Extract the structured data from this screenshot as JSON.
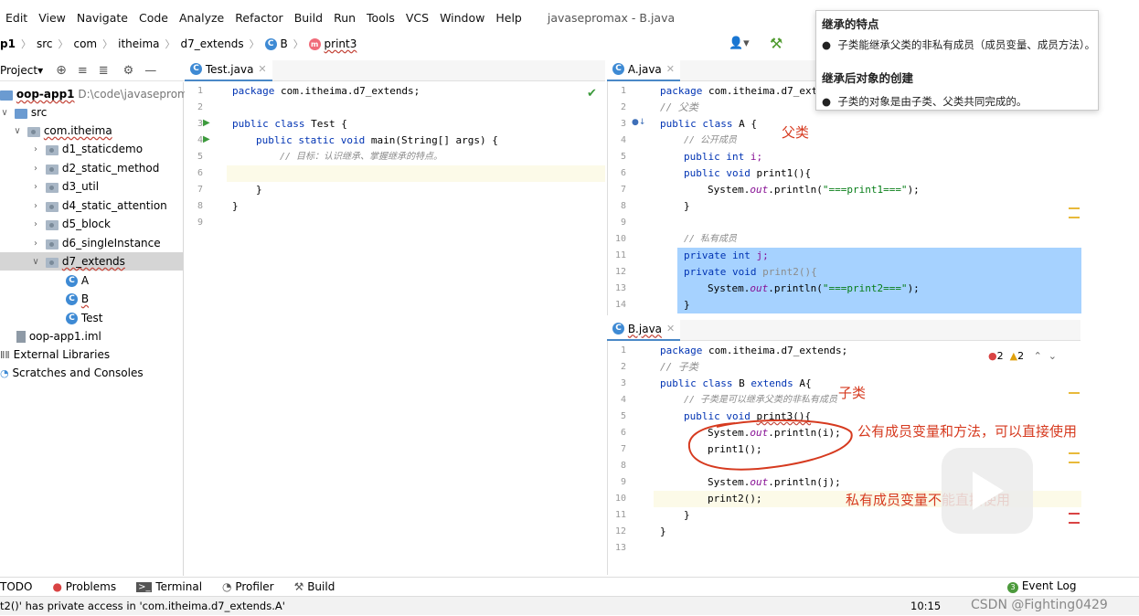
{
  "menu": [
    "Edit",
    "View",
    "Navigate",
    "Code",
    "Analyze",
    "Refactor",
    "Build",
    "Run",
    "Tools",
    "VCS",
    "Window",
    "Help"
  ],
  "window_title": "javasepromax - B.java",
  "breadcrumb": {
    "project": "p1",
    "items": [
      "src",
      "com",
      "itheima",
      "d7_extends"
    ],
    "class_name": "B",
    "method_name": "print3"
  },
  "project_panel": {
    "title": "Project",
    "root_name": "oop-app1",
    "root_path": "D:\\code\\javasepromax\\",
    "src": "src",
    "package": "com.itheima",
    "folders": [
      "d1_staticdemo",
      "d2_static_method",
      "d3_util",
      "d4_static_attention",
      "d5_block",
      "d6_singleInstance",
      "d7_extends"
    ],
    "classes": [
      "A",
      "B",
      "Test"
    ],
    "iml": "oop-app1.iml",
    "external": "External Libraries",
    "scratches": "Scratches and Consoles"
  },
  "test_editor": {
    "tab": "Test.java",
    "line_numbers": [
      "1",
      "2",
      "3",
      "4",
      "5",
      "6",
      "7",
      "8",
      "9"
    ],
    "lines": {
      "l1_kw": "package ",
      "l1_rest": "com.itheima.d7_extends;",
      "l3_kw": "public class ",
      "l3_rest": "Test {",
      "l4_kw": "public static void ",
      "l4_rest": "main(String[] args) {",
      "l5": "// 目标：认识继承、掌握继承的特点。",
      "l7": "}",
      "l8": "}"
    }
  },
  "a_editor": {
    "tab": "A.java",
    "line_numbers": [
      "1",
      "2",
      "3",
      "4",
      "5",
      "6",
      "7",
      "8",
      "9",
      "10",
      "11",
      "12",
      "13",
      "14"
    ],
    "lines": {
      "l1_kw": "package ",
      "l1_rest": "com.itheima.d7_ext",
      "l2": "// 父类",
      "l3_kw": "public class ",
      "l3_rest": "A {",
      "l4": "// 公开成员",
      "l5_kw": "public int ",
      "l5_rest": "i;",
      "l6_kw": "public void ",
      "l6_rest": "print1(){",
      "l7_a": "System.",
      "l7_b": "out",
      "l7_c": ".println(",
      "l7_d": "\"===print1===\"",
      "l7_e": ");",
      "l8": "}",
      "l10": "// 私有成员",
      "l11_kw": "private int ",
      "l11_rest": "j;",
      "l12_kw": "private void ",
      "l12_rest": "print2(){",
      "l13_a": "System.",
      "l13_b": "out",
      "l13_c": ".println(",
      "l13_d": "\"===print2===\"",
      "l13_e": ");",
      "l14": "}"
    }
  },
  "b_editor": {
    "tab": "B.java",
    "line_numbers": [
      "1",
      "2",
      "3",
      "4",
      "5",
      "6",
      "7",
      "8",
      "9",
      "10",
      "11",
      "12",
      "13"
    ],
    "errors": "2",
    "warnings": "2",
    "lines": {
      "l1_kw": "package ",
      "l1_rest": "com.itheima.d7_extends;",
      "l2": "// 子类",
      "l3_kw": "public class ",
      "l3_mid": "B ",
      "l3_kw2": "extends ",
      "l3_rest": "A{",
      "l4": "// 子类是可以继承父类的非私有成员",
      "l5_kw": "public void ",
      "l5_rest": "print3(){",
      "l6_a": "System.",
      "l6_b": "out",
      "l6_c": ".println(i);",
      "l7": "print1();",
      "l9_a": "System.",
      "l9_b": "out",
      "l9_c": ".println(j);",
      "l10": "print2();",
      "l11": "}",
      "l12": "}"
    }
  },
  "tooltip": {
    "h1": "继承的特点",
    "b1": "子类能继承父类的非私有成员（成员变量、成员方法）。",
    "h2": "继承后对象的创建",
    "b2": "子类的对象是由子类、父类共同完成的。"
  },
  "annotations": {
    "parent": "父类",
    "child": "子类",
    "public_use": "公有成员变量和方法，可以直接使用",
    "private_use": "私有成员变量不能直接使用"
  },
  "toolwindows": [
    "TODO",
    "Problems",
    "Terminal",
    "Profiler",
    "Build"
  ],
  "event_log": "Event Log",
  "event_count": "3",
  "status_message": "t2()' has private access in 'com.itheima.d7_extends.A'",
  "status_time": "10:15",
  "watermark": "CSDN @Fighting0429",
  "colors": {
    "selection": "#a6d2ff",
    "annotation": "#d63a1f",
    "accent": "#4a88c7"
  }
}
